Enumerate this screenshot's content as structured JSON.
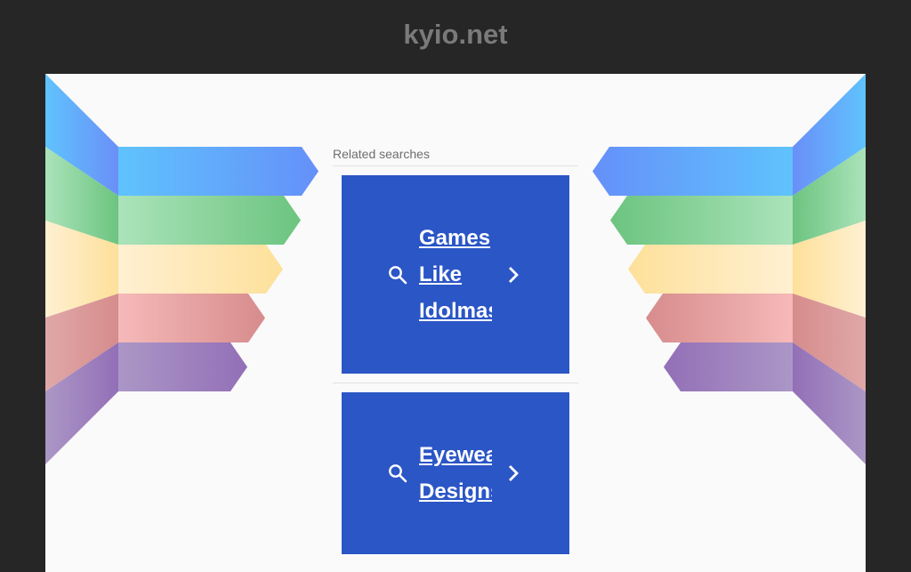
{
  "header": {
    "title": "kyio.net"
  },
  "related": {
    "label": "Related searches",
    "items": [
      {
        "lines": [
          "Games",
          "Like",
          "Idolmaster"
        ]
      },
      {
        "lines": [
          "Eyewear",
          "Designs"
        ]
      }
    ]
  },
  "colors": {
    "background": "#262626",
    "panel": "#fafafa",
    "card": "#2b56c6",
    "title": "#7a7a7a"
  },
  "icons": {
    "search": "search-icon",
    "chevron": "chevron-right-icon"
  }
}
